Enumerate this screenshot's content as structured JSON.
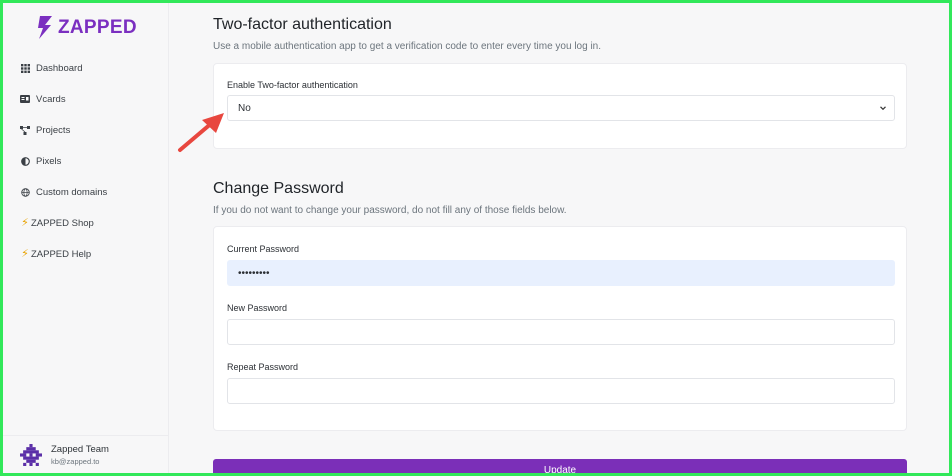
{
  "brand": {
    "name": "ZAPPED",
    "color": "#7b2fc0"
  },
  "sidebar": {
    "items": [
      {
        "label": "Dashboard",
        "icon": "grid-icon"
      },
      {
        "label": "Vcards",
        "icon": "id-card-icon"
      },
      {
        "label": "Projects",
        "icon": "project-diagram-icon"
      },
      {
        "label": "Pixels",
        "icon": "adjust-icon"
      },
      {
        "label": "Custom domains",
        "icon": "globe-icon"
      },
      {
        "label": "ZAPPED Shop",
        "icon": "bolt-icon"
      },
      {
        "label": "ZAPPED Help",
        "icon": "bolt-icon"
      }
    ],
    "user": {
      "name": "Zapped Team",
      "email": "kb@zapped.to"
    }
  },
  "two_factor": {
    "title": "Two-factor authentication",
    "subtitle": "Use a mobile authentication app to get a verification code to enter every time you log in.",
    "field_label": "Enable Two-factor authentication",
    "selected": "No"
  },
  "password": {
    "title": "Change Password",
    "subtitle": "If you do not want to change your password, do not fill any of those fields below.",
    "current_label": "Current Password",
    "current_value": "•••••••••",
    "new_label": "New Password",
    "repeat_label": "Repeat Password"
  },
  "update_label": "Update",
  "colors": {
    "accent": "#7b2fb8",
    "annotation_arrow": "#e8473f",
    "frame_border": "#32e85a"
  }
}
